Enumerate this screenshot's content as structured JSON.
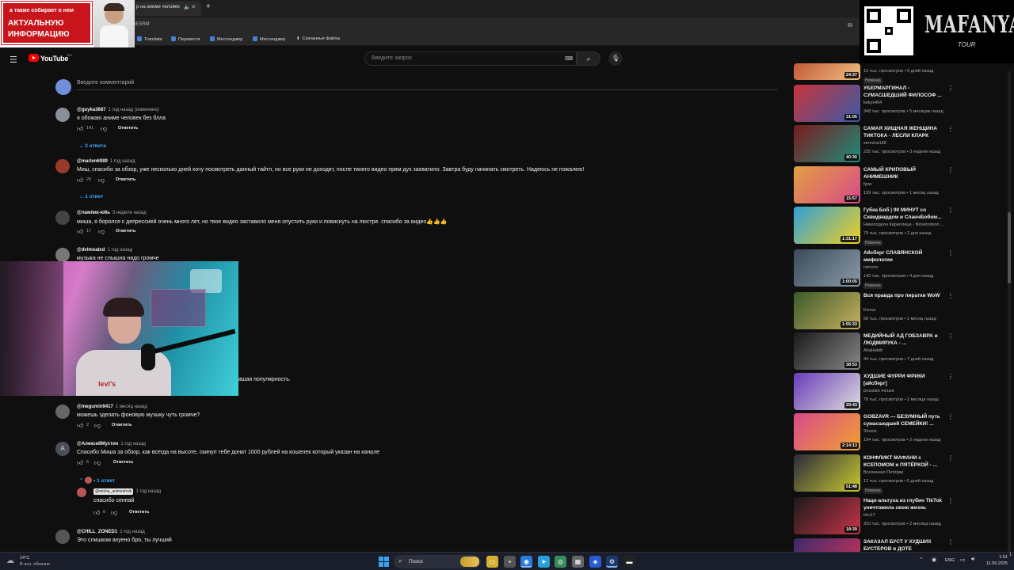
{
  "browser": {
    "tab_title": "р на аниме человек",
    "address_text": "6ESRM",
    "bookmarks": [
      "Translate",
      "Перевести",
      "Мессенджер",
      "Мессенджер",
      "Скачанные файлы"
    ]
  },
  "overlay": {
    "banner_line1": "а также собирает о нем",
    "banner_line2": "АКТУАЛЬНУЮ",
    "banner_line3": "ИНФОРМАЦИЮ",
    "logo_main": "MAFANYA",
    "logo_sub": "TOUR"
  },
  "youtube": {
    "logo_text": "YouTube",
    "region": "RU",
    "search_placeholder": "Введите запрос",
    "icons": {
      "menu": "hamburger-icon",
      "search": "search-icon",
      "mic": "mic-icon",
      "keyboard": "keyboard-icon"
    }
  },
  "comment_box": {
    "placeholder": "Введите комментарий"
  },
  "comments": [
    {
      "author": "@guyka3687",
      "time": "1 год назад (изменено)",
      "text": "я обожаю аниме человек без блла",
      "likes": "141",
      "reply": "Ответить",
      "replies": "2 ответа",
      "avatar_color": "#8a8f9a"
    },
    {
      "author": "@marlen6989",
      "time": "1 год назад",
      "text": "Миш, спасибо за обзор, уже несколько дней хочу посмотреть данный тайтл, но все руки не доходят, после твоего видео прям дух захватило. Завтра буду начинать смотреть. Надеюсь не пожалею!",
      "likes": "29",
      "reply": "Ответить",
      "replies": "1 ответ",
      "avatar_color": "#9a3a2a"
    },
    {
      "author": "@лампик-ю6ь",
      "time": "3 недели назад",
      "text": "миша, я боролся с депрессией очень много лет, но твое видео заставило меня опустить руки и повиснуть на люстре. спасибо за видео👍👍👍",
      "likes": "17",
      "reply": "Ответить",
      "avatar_color": "#444"
    },
    {
      "author": "@dvlmeatxd",
      "time": "1 год назад",
      "text": "музыка не слышна надо громче",
      "avatar_color": "#777"
    },
    {
      "text_fragment": "ашая популярность."
    },
    {
      "author": "@megumin9417",
      "time": "1 месяц назад",
      "text": "можешь зделать фоновую музыку чуть громче?",
      "likes": "2",
      "reply": "Ответить",
      "avatar_color": "#666"
    },
    {
      "author": "@АлексейМустин",
      "time": "1 год назад",
      "text": "Спасибо Миша за обзор, как всегда на высоте, скинул тебе донат 1000 рублей на кошелек который указан на канале",
      "likes": "6",
      "reply": "Ответить",
      "replies": "• 1 ответ",
      "avatar_letter": "A",
      "avatar_color": "#4a4f5a"
    },
    {
      "author": "@CHILL_ZONED1",
      "time": "1 год назад",
      "text": "Это слишком ахуено бро, ты лучший",
      "avatar_color": "#555"
    }
  ],
  "reply": {
    "author": "@misha_animeshnik",
    "time": "1 год назад",
    "text": "спасибо сенпай",
    "likes": "6",
    "reply": "Ответить"
  },
  "sidebar": [
    {
      "duration": "24:37",
      "meta": "13 тыс. просмотров • 5 дней назад",
      "badge": "Новинка",
      "colors": [
        "#c25a3a",
        "#f0c080"
      ]
    },
    {
      "title": "УБЕРМАРГИНАЛ - СУМАСШЕДШИЙ ФИЛОСОФ ...",
      "channel": "kekys404",
      "meta": "348 тыс. просмотров • 5 месяцев назад",
      "duration": "31:05",
      "colors": [
        "#c8343a",
        "#3a5aa8"
      ]
    },
    {
      "title": "САМАЯ ХИЩНАЯ ЖЕНЩИНА ТИКТОКА - ЛЕСЛИ КЛАРК",
      "channel": "serezha168",
      "meta": "235 тыс. просмотров • 3 недели назад",
      "duration": "40:30",
      "colors": [
        "#7a1a1e",
        "#1f8b7a"
      ]
    },
    {
      "title": "САМЫЙ КРИПОВЫЙ АНИМЕШНИК",
      "channel": "fgrw",
      "meta": "139 тыс. просмотров • 1 месяц назад",
      "duration": "15:57",
      "colors": [
        "#e2a040",
        "#d84a8a"
      ]
    },
    {
      "title": "Губка Боб | 90 МИНУТ со Сквидвардом и СпанчБобом...",
      "channel": "Никелодеон Кириллица - Nickelodeon ...",
      "meta": "79 тыс. просмотров • 2 дня назад",
      "duration": "1:31:17",
      "badge": "Новинка",
      "colors": [
        "#2f9fd8",
        "#f0d020"
      ]
    },
    {
      "title": "Айсберг СЛАВЯНСКОЙ мифологии",
      "channel": "netcore",
      "meta": "140 тыс. просмотров • 4 дня назад",
      "duration": "1:00:05",
      "badge": "Новинка",
      "colors": [
        "#3a4a5a",
        "#8a9aa8"
      ]
    },
    {
      "title": "Вся правда про пиратки WoW",
      "channel": "Kivrus",
      "meta": "68 тыс. просмотров • 1 месяц назад",
      "duration": "1:55:33",
      "colors": [
        "#3a5a2a",
        "#c8b060"
      ]
    },
    {
      "title": "МЕДИЙНЫЙ АД ГОБЗАВРА и ЛЮДМИРУКА - ...",
      "channel": "AhaHabib",
      "meta": "44 тыс. просмотров • 7 дней назад",
      "duration": "38:53",
      "colors": [
        "#1a1a1a",
        "#888"
      ]
    },
    {
      "title": "ХУДШИЕ ФУРРИ ФРИКИ [айсберг]",
      "channel": "prussian mouse",
      "meta": "78 тыс. просмотров • 2 месяца назад",
      "duration": "29:43",
      "colors": [
        "#6a3ab8",
        "#ddd"
      ]
    },
    {
      "title": "GOBZAVR — БЕЗУМНЫЙ путь сумасшедшей СЕМЕЙКИ! ...",
      "channel": "Shveis",
      "meta": "194 тыс. просмотров • 2 недели назад",
      "duration": "2:14:13",
      "colors": [
        "#d84a8a",
        "#f0a030"
      ]
    },
    {
      "title": "КОНФЛИКТ МАФАНИ с КСЕПОМОМ и ПЯТЁРКОЙ - ...",
      "channel": "Вселенная Пятёрки",
      "meta": "12 тыс. просмотров • 5 дней назад",
      "duration": "51:48",
      "badge": "Новинка",
      "colors": [
        "#2a2a3a",
        "#c8c830"
      ]
    },
    {
      "title": "Наци-альтуха из глубин TikTok уничтожила свою жизнь",
      "channel": "trkv17",
      "meta": "310 тыс. просмотров • 2 месяца назад",
      "duration": "18:39",
      "colors": [
        "#1a1a1a",
        "#c8344a"
      ]
    },
    {
      "title": "ЗАКАЗАЛ БУСТ У ХУДШИХ БУСТЕРОВ в ДОТЕ",
      "channel": "",
      "meta": "",
      "duration": "",
      "colors": [
        "#3a2a6a",
        "#d8345a"
      ]
    }
  ],
  "taskbar": {
    "weather_temp": "14°C",
    "weather_desc": "В осн. облачно",
    "search_label": "Поиск",
    "lang": "ENG",
    "time": "1:51",
    "date": "11.09.2025"
  }
}
